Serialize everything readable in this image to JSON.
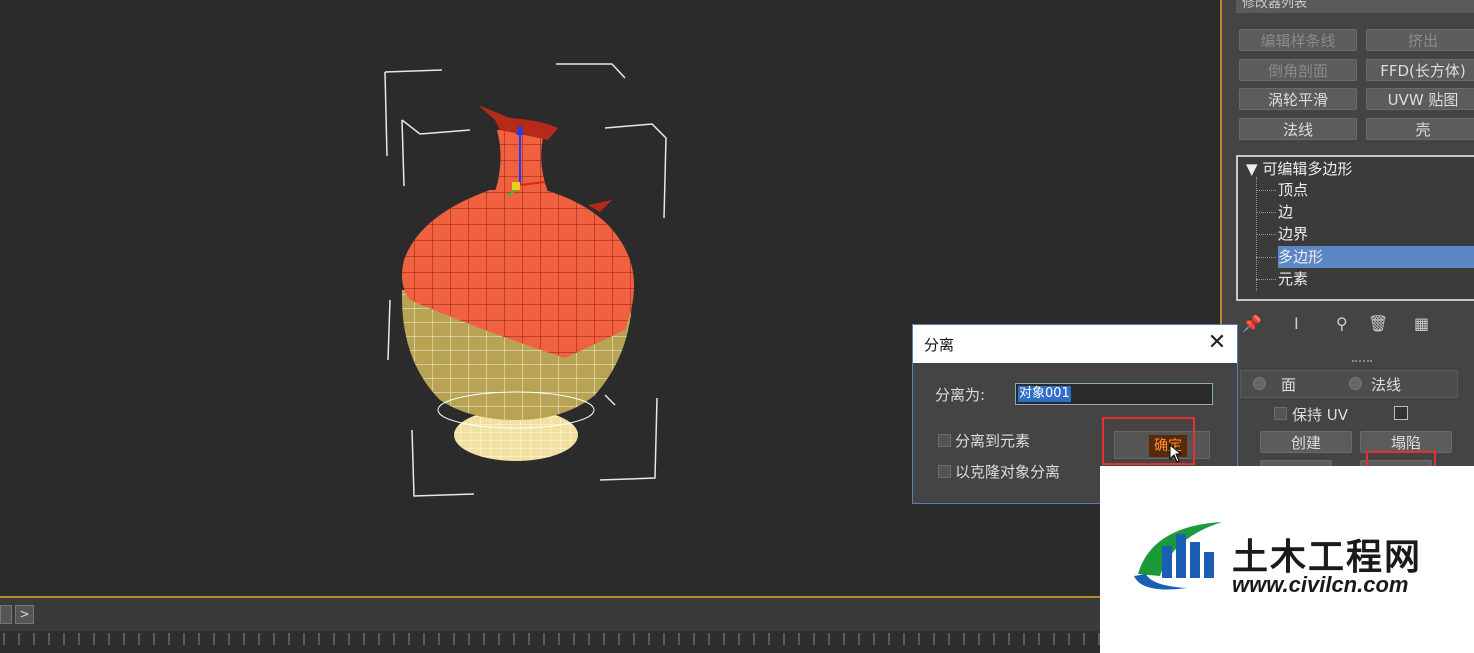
{
  "modifier_list": {
    "label": "修改器列表"
  },
  "modifier_buttons": [
    {
      "label": "编辑样条线",
      "enabled": false
    },
    {
      "label": "挤出",
      "enabled": false
    },
    {
      "label": "倒角剖面",
      "enabled": false
    },
    {
      "label": "FFD(长方体)",
      "enabled": true
    },
    {
      "label": "涡轮平滑",
      "enabled": true
    },
    {
      "label": "UVW 贴图",
      "enabled": true
    },
    {
      "label": "法线",
      "enabled": true
    },
    {
      "label": "壳",
      "enabled": true
    }
  ],
  "stack": {
    "root": "可编辑多边形",
    "items": [
      "顶点",
      "边",
      "边界",
      "多边形",
      "元素"
    ],
    "selected": "多边形"
  },
  "panel_lower": {
    "radio_face": "面",
    "radio_normal": "法线",
    "preserve_uv": "保持 UV",
    "create": "创建",
    "collapse": "塌陷"
  },
  "dialog": {
    "title": "分离",
    "close_glyph": "✕",
    "name_label": "分离为:",
    "name_value": "对象001",
    "option_element": "分离到元素",
    "option_clone": "以克隆对象分离",
    "ok_label": "确定"
  },
  "timeline": {
    "next_glyph": ">"
  },
  "watermark": {
    "title": "土木工程网",
    "url": "www.civilcn.com"
  },
  "colors": {
    "viewport_bg": "#2b2b2b",
    "vase_top": "#f2613f",
    "vase_bottom": "#b8a355",
    "vase_foot": "#f1e0a0",
    "selection_blue": "#5b87c4",
    "highlight_red": "#e53030",
    "viewport_border": "#b98a2d"
  }
}
